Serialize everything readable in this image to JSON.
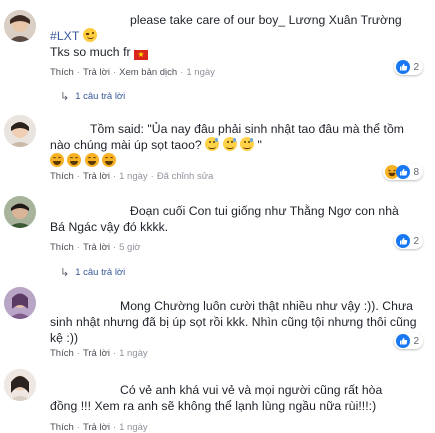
{
  "comments": [
    {
      "lines": [
        "please take care of our boy_ Lương Xuân Trường",
        "#LXT",
        "Tks so much fr"
      ],
      "actions": {
        "like": "Thích",
        "reply": "Trả lời",
        "translate": "Xem bản dịch",
        "time": "1 ngày"
      },
      "reactions": "2",
      "replies": "1 câu trả lời"
    },
    {
      "lines": [
        "Tồm said: \"Ủa nay đâu phải sinh nhật tao đâu mà thể tồm",
        "nào chúng mài úp sọt taoo?",
        "\""
      ],
      "actions": {
        "like": "Thích",
        "reply": "Trả lời",
        "time": "1 ngày",
        "edited": "Đã chỉnh sửa"
      },
      "reactions": "8"
    },
    {
      "lines": [
        "Đoạn cuối Con tui giống như Thằng Ngơ con nhà",
        "Bá Ngác vậy đó kkkk."
      ],
      "actions": {
        "like": "Thích",
        "reply": "Trả lời",
        "time": "5 giờ"
      },
      "reactions": "2",
      "replies": "1 câu trả lời"
    },
    {
      "lines": [
        "Mong Chường luôn cười thật nhiều như vậy :)). Chưa",
        "sinh nhật nhưng đã bị úp sọt rồi kkk. Nhìn cũng tội nhưng thôi cũng",
        "kệ :))"
      ],
      "actions": {
        "like": "Thích",
        "reply": "Trả lời",
        "time": "1 ngày"
      },
      "reactions": "2"
    },
    {
      "lines": [
        "Có vẻ anh khá vui vẻ và mọi người cũng rất hòa",
        "đồng !!! Xem ra anh sẽ không thể lạnh lùng ngầu nữa rùi!!!:)"
      ],
      "actions": {
        "like": "Thích",
        "reply": "Trả lời",
        "time": "1 ngày"
      }
    }
  ],
  "icons": {
    "like": "like-icon",
    "haha": "haha-icon",
    "reply_arrow": "reply-arrow-icon"
  },
  "colors": {
    "link": "#385898",
    "meta": "#90949c",
    "like_blue": "#1877f2",
    "haha_yellow": "#f7b125"
  }
}
